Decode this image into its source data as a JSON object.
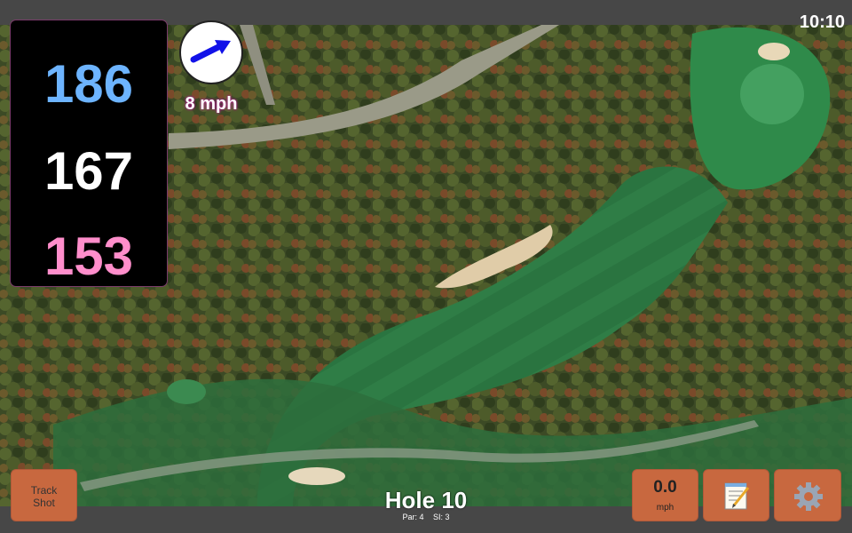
{
  "status": {
    "time": "10:10"
  },
  "distances": {
    "back": "186",
    "middle": "167",
    "front": "153"
  },
  "wind": {
    "speed": "8 mph",
    "icon": "wind-arrow-icon"
  },
  "buttons": {
    "track_shot_line1": "Track",
    "track_shot_line2": "Shot",
    "speed_value": "0.0",
    "speed_unit": "mph",
    "notes_icon": "notepad-icon",
    "settings_icon": "gear-icon"
  },
  "hole": {
    "title": "Hole 10",
    "par": "Par: 4",
    "si": "SI: 3"
  },
  "colors": {
    "back": "#6db4ff",
    "middle": "#ffffff",
    "front": "#ff8ecb",
    "button": "#c8683f"
  }
}
